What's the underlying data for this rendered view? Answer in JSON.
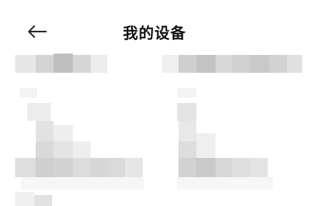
{
  "header": {
    "title": "我的设备",
    "back_icon": "arrow-left-icon"
  },
  "colors": {
    "background": "#ffffff",
    "title": "#111111",
    "pixel_blocks": [
      "#cfcfcf",
      "#bcbcbc",
      "#e3e3e3",
      "#f0f0f0"
    ]
  }
}
